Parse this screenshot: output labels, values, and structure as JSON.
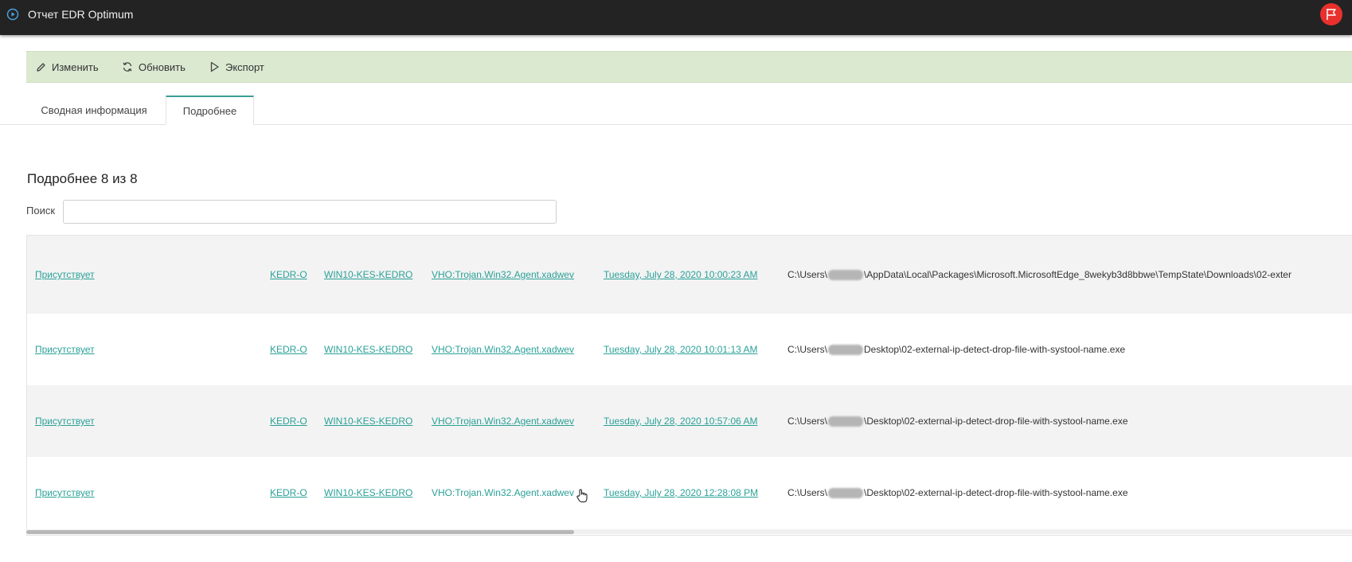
{
  "window": {
    "title": "Отчет EDR Optimum"
  },
  "toolbar": {
    "edit_label": "Изменить",
    "refresh_label": "Обновить",
    "export_label": "Экспорт"
  },
  "tabs": [
    {
      "label": "Сводная информация"
    },
    {
      "label": "Подробнее"
    }
  ],
  "main": {
    "section_title": "Подробнее 8 из 8",
    "search_label": "Поиск",
    "search_value": ""
  },
  "table": {
    "rows": [
      {
        "status": "Присутствует",
        "product": "KEDR-O",
        "host": "WIN10-KES-KEDRO",
        "detection": "VHO:Trojan.Win32.Agent.xadwev",
        "time": "Tuesday, July 28, 2020 10:00:23 AM",
        "path_prefix": "C:\\Users\\",
        "path_suffix": "\\AppData\\Local\\Packages\\Microsoft.MicrosoftEdge_8wekyb3d8bbwe\\TempState\\Downloads\\02-exter"
      },
      {
        "status": "Присутствует",
        "product": "KEDR-O",
        "host": "WIN10-KES-KEDRO",
        "detection": "VHO:Trojan.Win32.Agent.xadwev",
        "time": "Tuesday, July 28, 2020 10:01:13 AM",
        "path_prefix": "C:\\Users\\",
        "path_suffix": "Desktop\\02-external-ip-detect-drop-file-with-systool-name.exe"
      },
      {
        "status": "Присутствует",
        "product": "KEDR-O",
        "host": "WIN10-KES-KEDRO",
        "detection": "VHO:Trojan.Win32.Agent.xadwev",
        "time": "Tuesday, July 28, 2020 10:57:06 AM",
        "path_prefix": "C:\\Users\\",
        "path_suffix": "\\Desktop\\02-external-ip-detect-drop-file-with-systool-name.exe"
      },
      {
        "status": "Присутствует",
        "product": "KEDR-O",
        "host": "WIN10-KES-KEDRO",
        "detection": "VHO:Trojan.Win32.Agent.xadwev",
        "time": "Tuesday, July 28, 2020 12:28:08 PM",
        "path_prefix": "C:\\Users\\",
        "path_suffix": "\\Desktop\\02-external-ip-detect-drop-file-with-systool-name.exe"
      }
    ]
  },
  "colors": {
    "titlebar": "#232323",
    "toolbar": "#dbe9d1",
    "link": "#2aa198",
    "flag_button": "#e8312d",
    "active_tab_accent": "#3a9f96"
  },
  "icons": {
    "app": "play-circle-icon",
    "flag": "flag-icon",
    "edit": "pencil-icon",
    "refresh": "refresh-icon",
    "export": "play-triangle-icon"
  }
}
